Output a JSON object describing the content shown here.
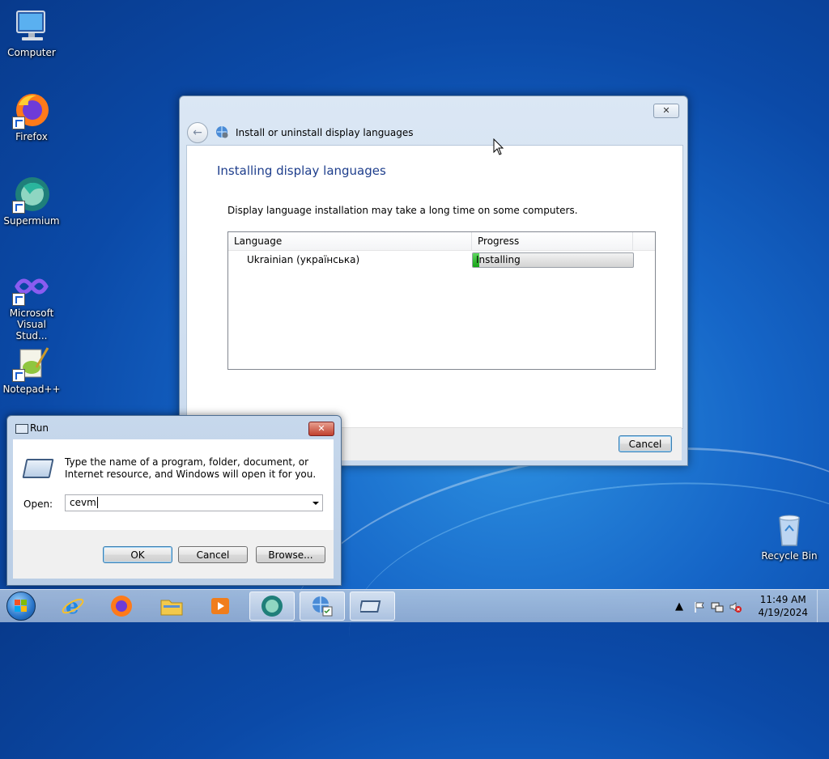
{
  "desktop": {
    "icons": [
      {
        "label": "Computer",
        "icon": "computer-icon"
      },
      {
        "label": "Firefox",
        "icon": "firefox-icon"
      },
      {
        "label": "Supermium",
        "icon": "supermium-icon"
      },
      {
        "label": "Microsoft Visual Stud...",
        "icon": "visual-studio-icon"
      },
      {
        "label": "Notepad++",
        "icon": "notepadpp-icon"
      },
      {
        "label": "Recycle Bin",
        "icon": "recycle-bin-icon"
      }
    ]
  },
  "install_window": {
    "nav_title": "Install or uninstall display languages",
    "heading": "Installing display languages",
    "description": "Display language installation may take a long time on some computers.",
    "columns": [
      "Language",
      "Progress"
    ],
    "rows": [
      {
        "language": "Ukrainian (українська)",
        "progress_text": "Installing",
        "progress_fraction": 0.04
      }
    ],
    "cancel_label": "Cancel",
    "close_glyph": "✕"
  },
  "run_dialog": {
    "title": "Run",
    "description": "Type the name of a program, folder, document, or Internet resource, and Windows will open it for you.",
    "open_label": "Open:",
    "open_value": "cevm",
    "ok_label": "OK",
    "cancel_label": "Cancel",
    "browse_label": "Browse...",
    "close_glyph": "✕"
  },
  "taskbar": {
    "items": [
      "start-button",
      "internet-explorer",
      "firefox",
      "file-explorer",
      "media-player",
      "supermium",
      "language-settings",
      "run"
    ],
    "clock_time": "11:49 AM",
    "clock_date": "4/19/2024",
    "tray_expand_glyph": "▲"
  }
}
